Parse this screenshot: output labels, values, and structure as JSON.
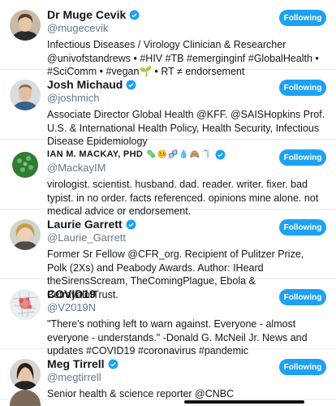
{
  "follow_label": "Following",
  "accounts": [
    {
      "name": "Dr Muge Cevik",
      "handle": "@mugecevik",
      "verified": true,
      "bio": "Infectious Diseases / Virology Clinician & Researcher @univofstandrews • #HIV #TB #emerginginf #GlobalHealth • #SciComm • #vegan🌱 • RT ≠ endorsement"
    },
    {
      "name": "Josh Michaud",
      "handle": "@joshmich",
      "verified": true,
      "bio": "Associate Director Global Health @KFF. @SAISHopkins Prof. U.S. & International Health Policy, Health Security, Infectious Disease Epidemiology"
    },
    {
      "name": "IAN M. MACKAY, PHD",
      "name_emoji": "🦠🤒🧬💧🙈🧻",
      "handle": "@MackayIM",
      "verified": true,
      "bio": "virologist. scientist. husband. dad. reader. writer. fixer. bad typist. in no order. facts referenced. opinions mine alone. not medical advice or endorsement."
    },
    {
      "name": "Laurie Garrett",
      "handle": "@Laurie_Garrett",
      "verified": true,
      "bio": "Former Sr Fellow @CFR_org. Recipient of Pulitzer Prize, Polk (2Xs) and Peabody Awards. Author: IHeard theSirensScream, TheComingPlague, Ebola & BetrayalofTrust."
    },
    {
      "name": "COVID19",
      "handle": "@V2019N",
      "verified": false,
      "bio": "\"There's nothing left to warn against. Everyone - almost everyone - understands.\" -Donald G. McNeil Jr. News and updates #COVID19 #coronavirus #pandemic"
    },
    {
      "name": "Meg Tirrell",
      "handle": "@megtirrell",
      "verified": true,
      "bio": "Senior health & science reporter @CNBC"
    }
  ],
  "colors": {
    "accent": "#1da1f2",
    "handle": "#657786",
    "divider": "#e6ecf0"
  }
}
